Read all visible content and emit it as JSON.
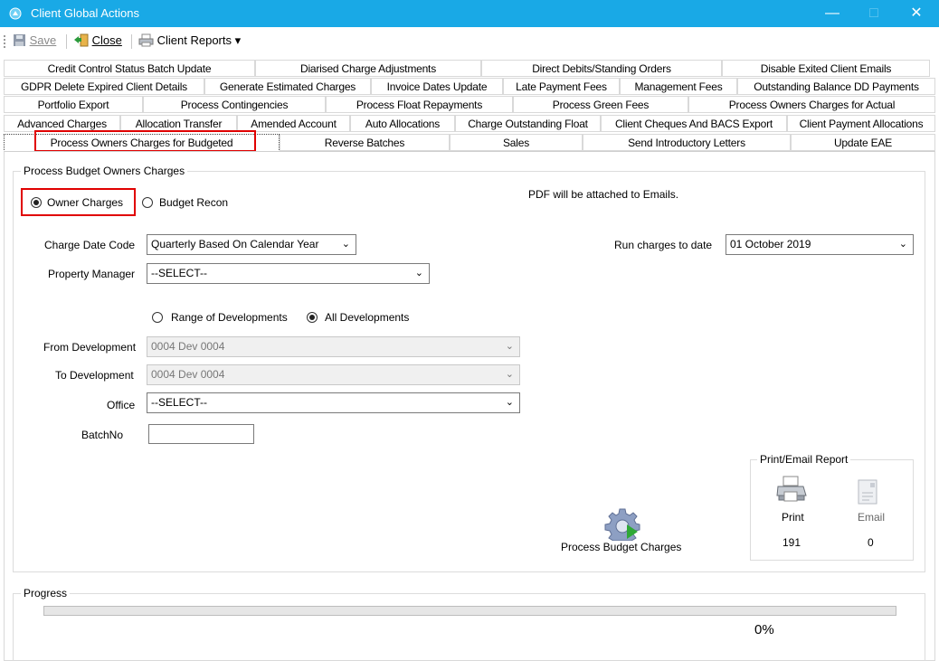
{
  "window": {
    "title": "Client Global Actions",
    "controls": {
      "minimize": "—",
      "maximize": "□",
      "close": "✕"
    }
  },
  "toolbar": {
    "save_label": "Save",
    "close_label": "Close",
    "reports_label": "Client Reports ▾"
  },
  "tabs": {
    "row1": [
      "Credit Control Status Batch Update",
      "Diarised Charge Adjustments",
      "Direct Debits/Standing Orders",
      "Disable Exited Client Emails"
    ],
    "row2": [
      "GDPR Delete Expired Client Details",
      "Generate Estimated Charges",
      "Invoice Dates Update",
      "Late Payment Fees",
      "Management Fees",
      "Outstanding Balance DD Payments"
    ],
    "row3": [
      "Portfolio Export",
      "Process Contingencies",
      "Process Float Repayments",
      "Process Green Fees",
      "Process Owners Charges for Actual"
    ],
    "row4": [
      "Advanced Charges",
      "Allocation Transfer",
      "Amended Account",
      "Auto Allocations",
      "Charge Outstanding Float",
      "Client Cheques And BACS Export",
      "Client Payment Allocations"
    ],
    "row5": [
      "Process Owners Charges for Budgeted",
      "Reverse Batches",
      "Sales",
      "Send Introductory Letters",
      "Update EAE"
    ]
  },
  "main": {
    "group_title": "Process Budget Owners Charges",
    "mode": {
      "owner_label": "Owner Charges",
      "recon_label": "Budget Recon",
      "selected": "Owner Charges"
    },
    "pdf_note": "PDF will be attached to Emails.",
    "charge_date_code": {
      "label": "Charge Date Code",
      "value": "Quarterly Based On Calendar Year"
    },
    "run_charges": {
      "label": "Run charges to date",
      "value": "01 October 2019"
    },
    "property_manager": {
      "label": "Property Manager",
      "value": "--SELECT--"
    },
    "dev_scope": {
      "range_label": "Range of Developments",
      "all_label": "All Developments",
      "selected": "All Developments"
    },
    "from_dev": {
      "label": "From Development",
      "value": "0004 Dev 0004"
    },
    "to_dev": {
      "label": "To Development",
      "value": "0004 Dev 0004"
    },
    "office": {
      "label": "Office",
      "value": "--SELECT--"
    },
    "batchno": {
      "label": "BatchNo",
      "value": ""
    },
    "process_button_label": "Process Budget Charges",
    "report": {
      "title": "Print/Email Report",
      "print_label": "Print",
      "email_label": "Email",
      "print_count": "191",
      "email_count": "0"
    }
  },
  "progress": {
    "title": "Progress",
    "percent_text": "0%",
    "value": 0
  },
  "colors": {
    "titlebar": "#19a9e6",
    "highlight": "#e00000",
    "progress_track": "#e6e6e6"
  }
}
